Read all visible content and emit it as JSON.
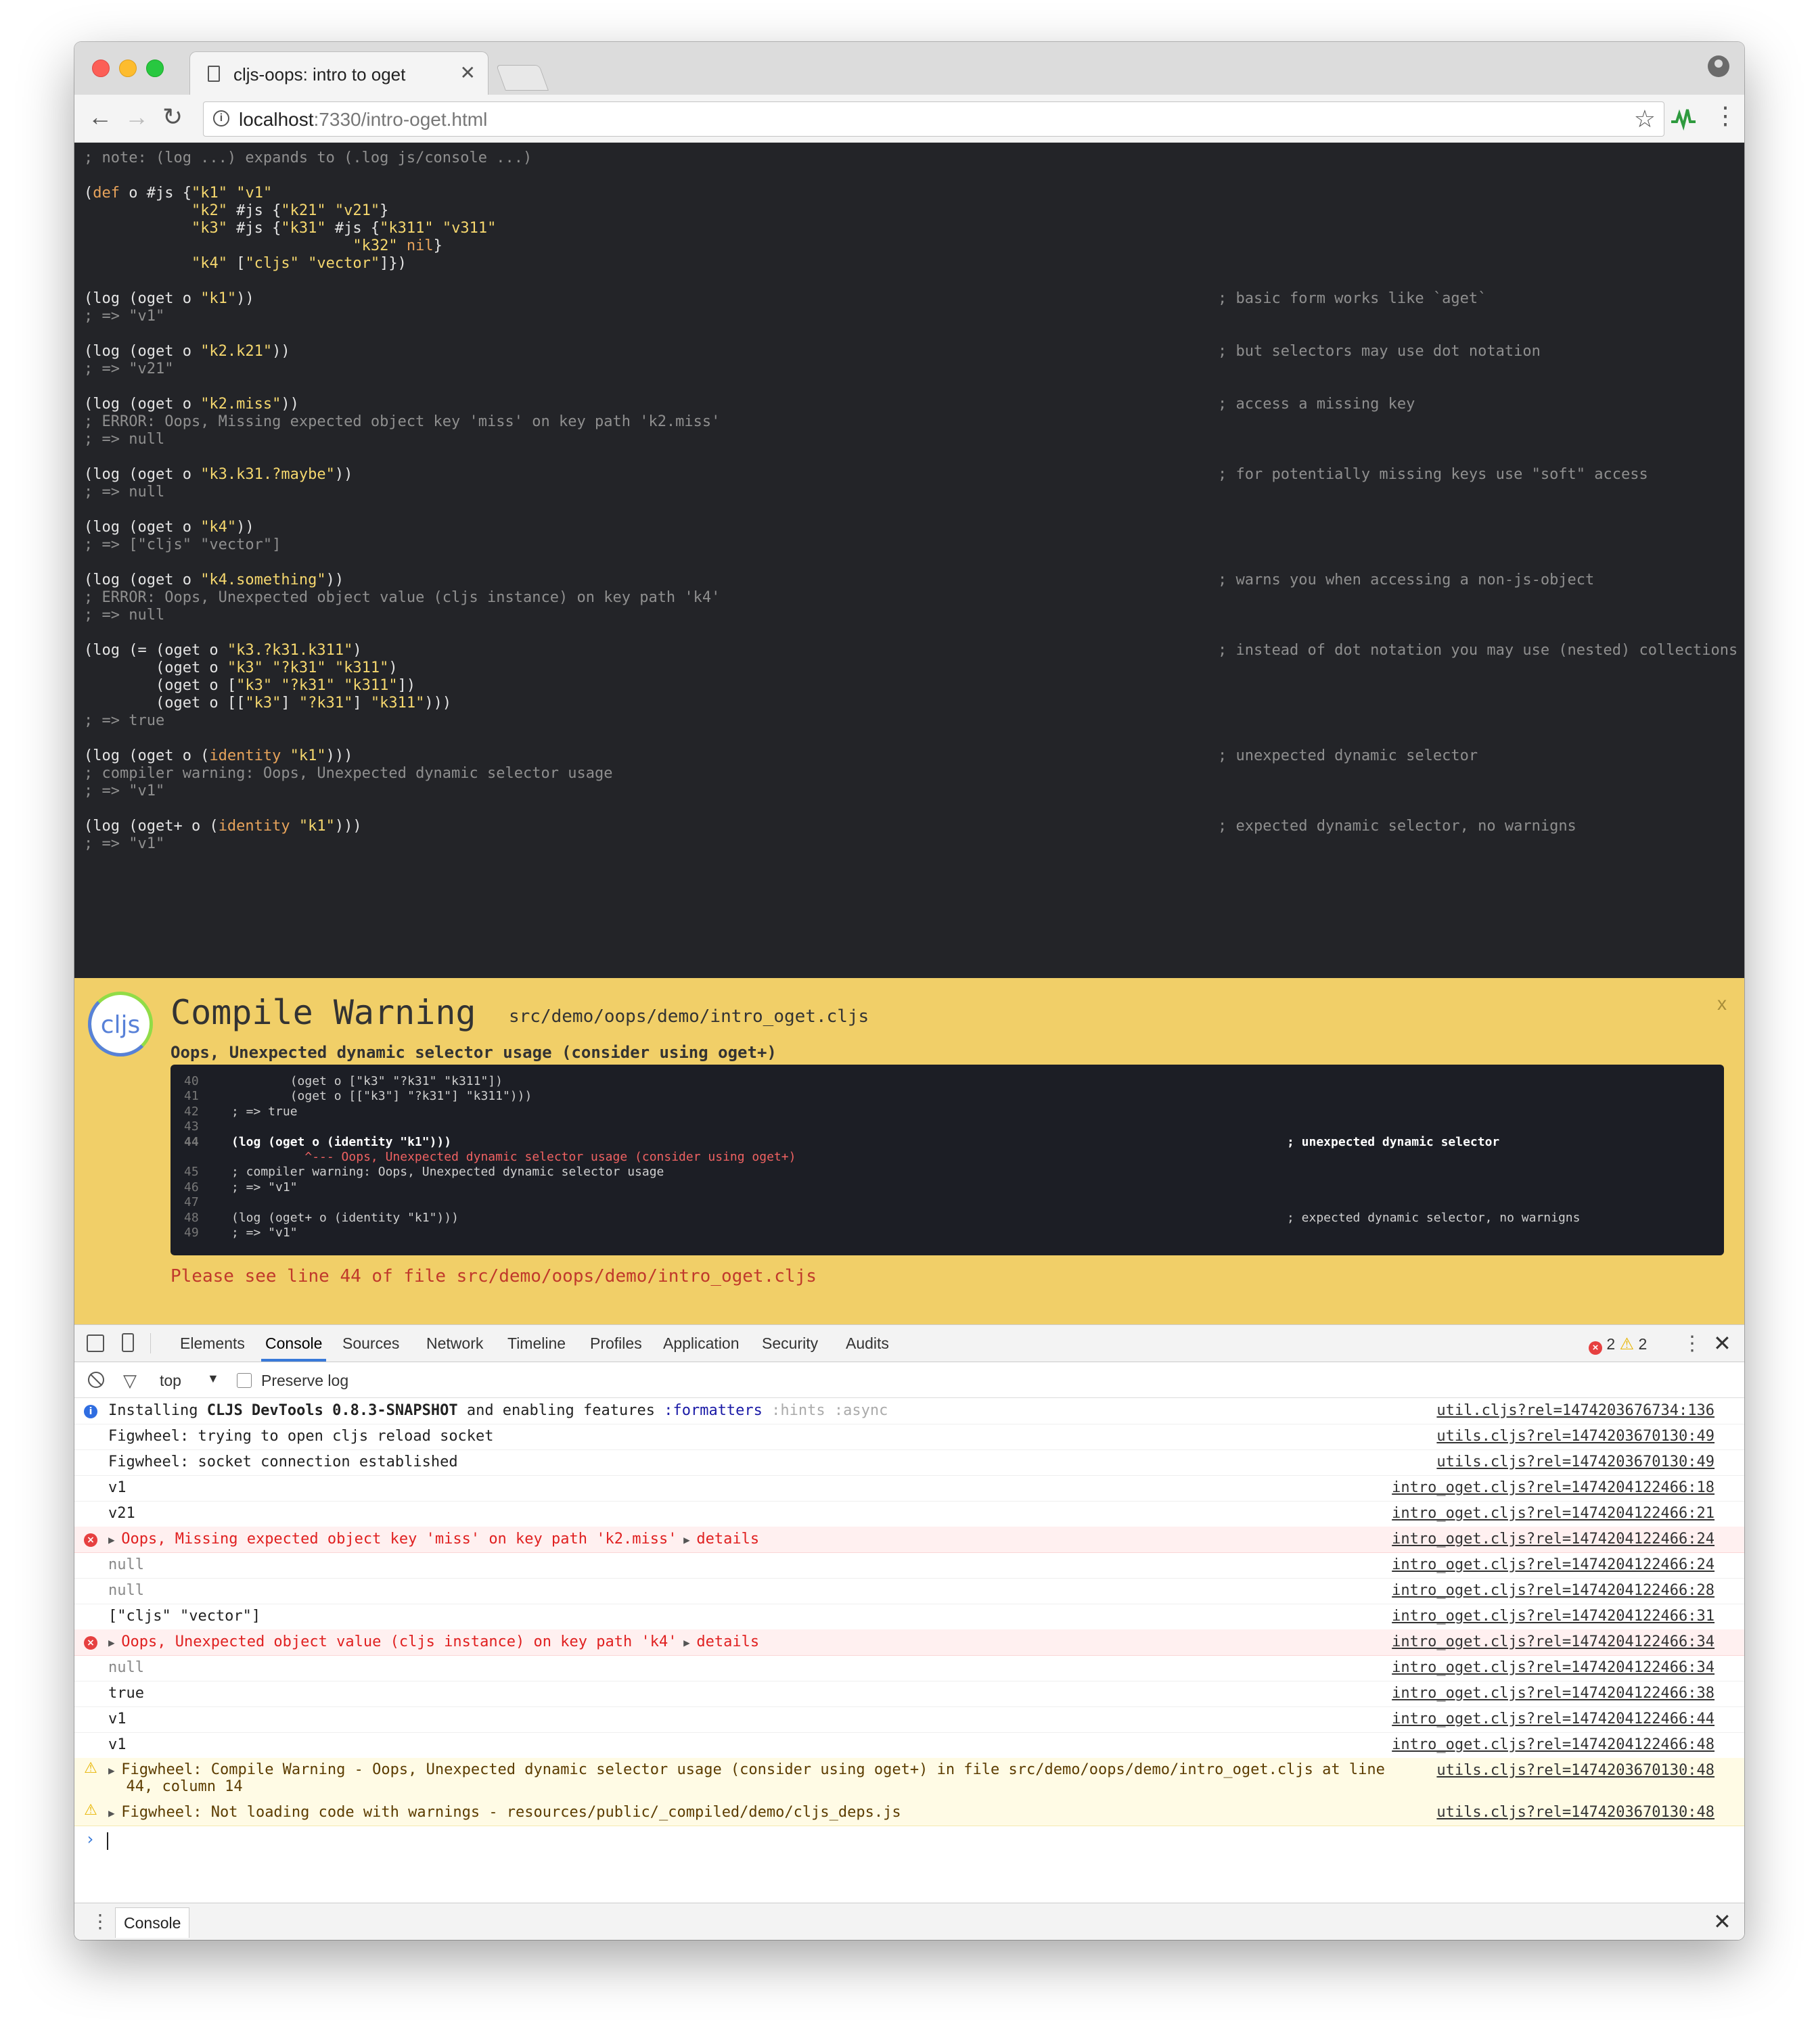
{
  "browser": {
    "tab_title": "cljs-oops: intro to oget",
    "tab_close": "✕",
    "url_host": "localhost",
    "url_rest": ":7330/intro-oget.html",
    "back": "←",
    "forward": "→",
    "reload": "↻",
    "star": "☆",
    "menu": "⋮"
  },
  "page": {
    "code_lines": [
      "; note: (log ...) expands to (.log js/console ...)",
      "",
      "(def o #js {\"k1\" \"v1\"",
      "            \"k2\" #js {\"k21\" \"v21\"}",
      "            \"k3\" #js {\"k31\" #js {\"k311\" \"v311\"",
      "                              \"k32\" nil}",
      "            \"k4\" [\"cljs\" \"vector\"]})",
      "",
      "(log (oget o \"k1\"))",
      "; => \"v1\"",
      "",
      "(log (oget o \"k2.k21\"))",
      "; => \"v21\"",
      "",
      "(log (oget o \"k2.miss\"))",
      "; ERROR: Oops, Missing expected object key 'miss' on key path 'k2.miss'",
      "; => null",
      "",
      "(log (oget o \"k3.k31.?maybe\"))",
      "; => null",
      "",
      "(log (oget o \"k4\"))",
      "; => [\"cljs\" \"vector\"]",
      "",
      "(log (oget o \"k4.something\"))",
      "; ERROR: Oops, Unexpected object value (cljs instance) on key path 'k4'",
      "; => null",
      "",
      "(log (= (oget o \"k3.?k31.k311\")",
      "        (oget o \"k3\" \"?k31\" \"k311\")",
      "        (oget o [\"k3\" \"?k31\" \"k311\"])",
      "        (oget o [[\"k3\"] \"?k31\"] \"k311\")))",
      "; => true",
      "",
      "(log (oget o (identity \"k1\")))",
      "; compiler warning: Oops, Unexpected dynamic selector usage",
      "; => \"v1\"",
      "",
      "(log (oget+ o (identity \"k1\")))",
      "; => \"v1\""
    ],
    "comments": [
      {
        "line": 8,
        "text": "; basic form works like `aget`"
      },
      {
        "line": 11,
        "text": "; but selectors may use dot notation"
      },
      {
        "line": 14,
        "text": "; access a missing key"
      },
      {
        "line": 18,
        "text": "; for potentially missing keys use \"soft\" access"
      },
      {
        "line": 24,
        "text": "; warns you when accessing a non-js-object"
      },
      {
        "line": 28,
        "text": "; instead of dot notation you may use (nested) collections"
      },
      {
        "line": 34,
        "text": "; unexpected dynamic selector"
      },
      {
        "line": 38,
        "text": "; expected dynamic selector, no warnigns"
      }
    ]
  },
  "warning": {
    "logo_text": "cljs",
    "title": "Compile Warning",
    "file": "src/demo/oops/demo/intro_oget.cljs",
    "close": "x",
    "message": "Oops, Unexpected dynamic selector usage (consider using oget+)",
    "snippet": [
      {
        "ln": "40",
        "code": "        (oget o [\"k3\" \"?k31\" \"k311\"])",
        "comment": ""
      },
      {
        "ln": "41",
        "code": "        (oget o [[\"k3\"] \"?k31\"] \"k311\")))",
        "comment": ""
      },
      {
        "ln": "42",
        "code": "; => true",
        "comment": ""
      },
      {
        "ln": "43",
        "code": "",
        "comment": ""
      },
      {
        "ln": "44",
        "code": "(log (oget o (identity \"k1\")))",
        "comment": "; unexpected dynamic selector"
      },
      {
        "ln": "",
        "code": "          ^--- Oops, Unexpected dynamic selector usage (consider using oget+)",
        "comment": ""
      },
      {
        "ln": "45",
        "code": "; compiler warning: Oops, Unexpected dynamic selector usage",
        "comment": ""
      },
      {
        "ln": "46",
        "code": "; => \"v1\"",
        "comment": ""
      },
      {
        "ln": "47",
        "code": "",
        "comment": ""
      },
      {
        "ln": "48",
        "code": "(log (oget+ o (identity \"k1\")))",
        "comment": "; expected dynamic selector, no warnigns"
      },
      {
        "ln": "49",
        "code": "; => \"v1\"",
        "comment": ""
      }
    ],
    "footer": "Please see line 44 of file src/demo/oops/demo/intro_oget.cljs"
  },
  "devtools": {
    "tabs": [
      "Elements",
      "Console",
      "Sources",
      "Network",
      "Timeline",
      "Profiles",
      "Application",
      "Security",
      "Audits"
    ],
    "active_tab": "Console",
    "error_count": "2",
    "warning_count": "2",
    "context": "top",
    "preserve_log": "Preserve log",
    "drawer_tab": "Console",
    "rows": [
      {
        "level": "info",
        "src": "util.cljs?rel=1474203676734:136"
      },
      {
        "level": "log",
        "text": "Figwheel: trying to open cljs reload socket",
        "color": "blue",
        "src": "utils.cljs?rel=1474203670130:49"
      },
      {
        "level": "log",
        "text": "Figwheel: socket connection established",
        "color": "blue",
        "src": "utils.cljs?rel=1474203670130:49"
      },
      {
        "level": "log",
        "text": "v1",
        "src": "intro_oget.cljs?rel=1474204122466:18"
      },
      {
        "level": "log",
        "text": "v21",
        "src": "intro_oget.cljs?rel=1474204122466:21"
      },
      {
        "level": "error",
        "text": "Oops, Missing expected object key 'miss' on key path 'k2.miss'",
        "details": "details",
        "src": "intro_oget.cljs?rel=1474204122466:24"
      },
      {
        "level": "log",
        "text": "null",
        "color": "grey",
        "src": "intro_oget.cljs?rel=1474204122466:24"
      },
      {
        "level": "log",
        "text": "null",
        "color": "grey",
        "src": "intro_oget.cljs?rel=1474204122466:28"
      },
      {
        "level": "log",
        "text": "[\"cljs\" \"vector\"]",
        "src": "intro_oget.cljs?rel=1474204122466:31"
      },
      {
        "level": "error",
        "text": "Oops, Unexpected object value (cljs instance) on key path 'k4'",
        "details": "details",
        "src": "intro_oget.cljs?rel=1474204122466:34"
      },
      {
        "level": "log",
        "text": "null",
        "color": "grey",
        "src": "intro_oget.cljs?rel=1474204122466:34"
      },
      {
        "level": "log",
        "text": "true",
        "color": "magenta",
        "src": "intro_oget.cljs?rel=1474204122466:38"
      },
      {
        "level": "log",
        "text": "v1",
        "src": "intro_oget.cljs?rel=1474204122466:44"
      },
      {
        "level": "log",
        "text": "v1",
        "src": "intro_oget.cljs?rel=1474204122466:48"
      },
      {
        "level": "warning",
        "text": "Figwheel: Compile Warning - Oops, Unexpected dynamic selector usage (consider using oget+) in file src/demo/oops/demo/intro_oget.cljs at line",
        "text2": "44, column 14",
        "src": "utils.cljs?rel=1474203670130:48"
      },
      {
        "level": "warning",
        "text": "Figwheel: Not loading code with warnings - resources/public/_compiled/demo/cljs_deps.js",
        "src": "utils.cljs?rel=1474203670130:48"
      }
    ],
    "info_parts": {
      "prefix": "Installing ",
      "bold": "CLJS DevTools 0.8.3-SNAPSHOT",
      "mid": " and enabling features ",
      "feature_on": ":formatters",
      "features_off": " :hints :async"
    }
  }
}
